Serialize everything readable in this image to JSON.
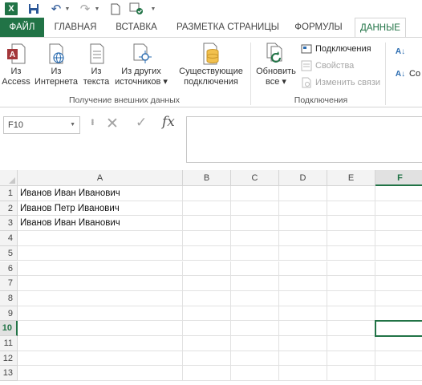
{
  "quick_access": {
    "app_icon": "excel-icon",
    "items": [
      "save-icon",
      "undo-icon",
      "redo-icon",
      "new-file-icon",
      "connections-icon",
      "customize-arrow-icon"
    ]
  },
  "tabs": [
    {
      "label": "ФАЙЛ"
    },
    {
      "label": "ГЛАВНАЯ"
    },
    {
      "label": "ВСТАВКА"
    },
    {
      "label": "РАЗМЕТКА СТРАНИЦЫ"
    },
    {
      "label": "ФОРМУЛЫ"
    },
    {
      "label": "ДАННЫЕ"
    }
  ],
  "ribbon": {
    "external_data": {
      "caption": "Получение внешних данных",
      "buttons": [
        {
          "line1": "Из",
          "line2": "Access",
          "icon": "access-icon"
        },
        {
          "line1": "Из",
          "line2": "Интернета",
          "icon": "web-icon"
        },
        {
          "line1": "Из",
          "line2": "текста",
          "icon": "text-file-icon"
        },
        {
          "line1": "Из других",
          "line2": "источников ▾",
          "icon": "other-sources-icon"
        }
      ],
      "existing": {
        "line1": "Существующие",
        "line2": "подключения",
        "icon": "existing-connections-icon"
      }
    },
    "connections": {
      "caption": "Подключения",
      "refresh": {
        "line1": "Обновить",
        "line2": "все ▾",
        "icon": "refresh-icon"
      },
      "small": [
        {
          "label": "Подключения",
          "disabled": false
        },
        {
          "label": "Свойства",
          "disabled": true
        },
        {
          "label": "Изменить связи",
          "disabled": true
        }
      ]
    },
    "sort": {
      "label": "Со"
    }
  },
  "formula_bar": {
    "name_box": "F10",
    "fx": "fx",
    "content": ""
  },
  "sheet": {
    "columns": [
      "A",
      "B",
      "C",
      "D",
      "E",
      "F"
    ],
    "active_column": "F",
    "rows": [
      "1",
      "2",
      "3",
      "4",
      "5",
      "6",
      "7",
      "8",
      "9",
      "10",
      "11",
      "12",
      "13"
    ],
    "active_row": "10",
    "active_cell": "F10",
    "cells": {
      "A1": "Иванов Иван Иванович",
      "A2": "Иванов Петр Иванович",
      "A3": "Иванов Иван  Иванович"
    }
  },
  "colors": {
    "accent": "#217346",
    "header_bg": "#f3f3f3",
    "gridline": "#e1e1e1"
  }
}
